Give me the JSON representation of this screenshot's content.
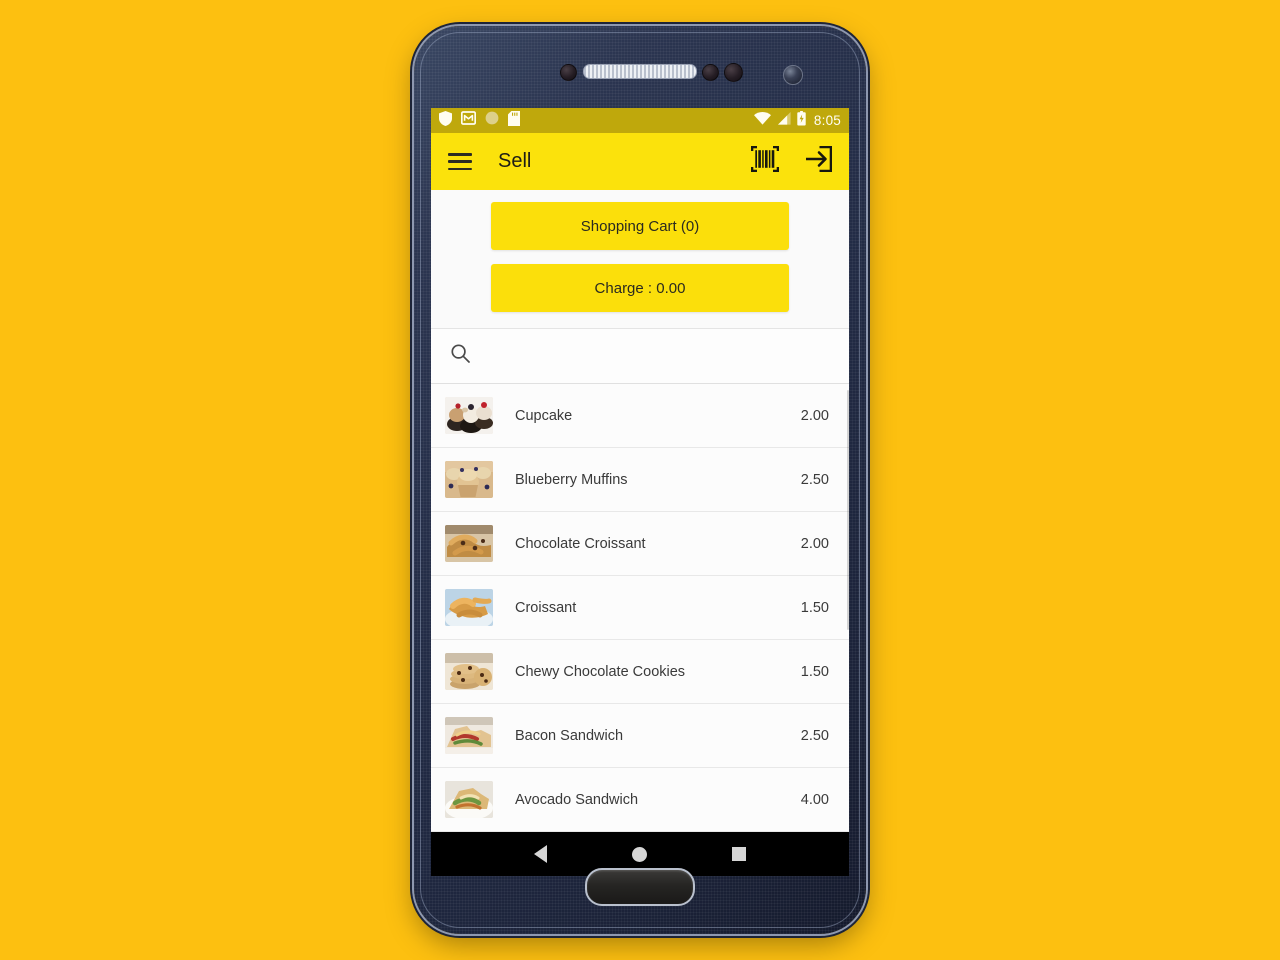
{
  "device": {
    "name": "android-phone-mockup",
    "background_color": "#FDC010",
    "bezel_color": "#222b45"
  },
  "status_bar": {
    "background_color": "#BFA80C",
    "time": "8:05",
    "left_icons": [
      "shield-icon",
      "gmail-icon",
      "circle-icon",
      "sd-card-icon"
    ],
    "right_icons": [
      "wifi-icon",
      "cellular-signal-icon",
      "battery-charging-icon"
    ]
  },
  "app_bar": {
    "background_color": "#FBE20C",
    "title": "Sell",
    "menu_icon": "hamburger-menu-icon",
    "actions": [
      {
        "icon": "barcode-scanner-icon",
        "name": "barcode-scan-button"
      },
      {
        "icon": "logout-icon",
        "name": "logout-button"
      }
    ]
  },
  "actions_panel": {
    "cart_button_label": "Shopping Cart (0)",
    "charge_button_label": "Charge : 0.00",
    "button_color": "#FBDF0B"
  },
  "search": {
    "icon": "search-icon",
    "value": "",
    "placeholder": ""
  },
  "products": {
    "columns": [
      "image",
      "name",
      "price"
    ],
    "items": [
      {
        "name": "Cupcake",
        "price": "2.00",
        "thumb": "cupcakes-photo"
      },
      {
        "name": "Blueberry Muffins",
        "price": "2.50",
        "thumb": "muffins-photo"
      },
      {
        "name": "Chocolate Croissant",
        "price": "2.00",
        "thumb": "chocolate-croissant-photo"
      },
      {
        "name": "Croissant",
        "price": "1.50",
        "thumb": "croissant-photo"
      },
      {
        "name": "Chewy Chocolate Cookies",
        "price": "1.50",
        "thumb": "cookies-photo"
      },
      {
        "name": "Bacon Sandwich",
        "price": "2.50",
        "thumb": "bacon-sandwich-photo"
      },
      {
        "name": "Avocado Sandwich",
        "price": "4.00",
        "thumb": "avocado-sandwich-photo"
      }
    ]
  },
  "nav_bar": {
    "background_color": "#000000",
    "buttons": [
      "back-button",
      "home-button",
      "recents-button"
    ]
  }
}
